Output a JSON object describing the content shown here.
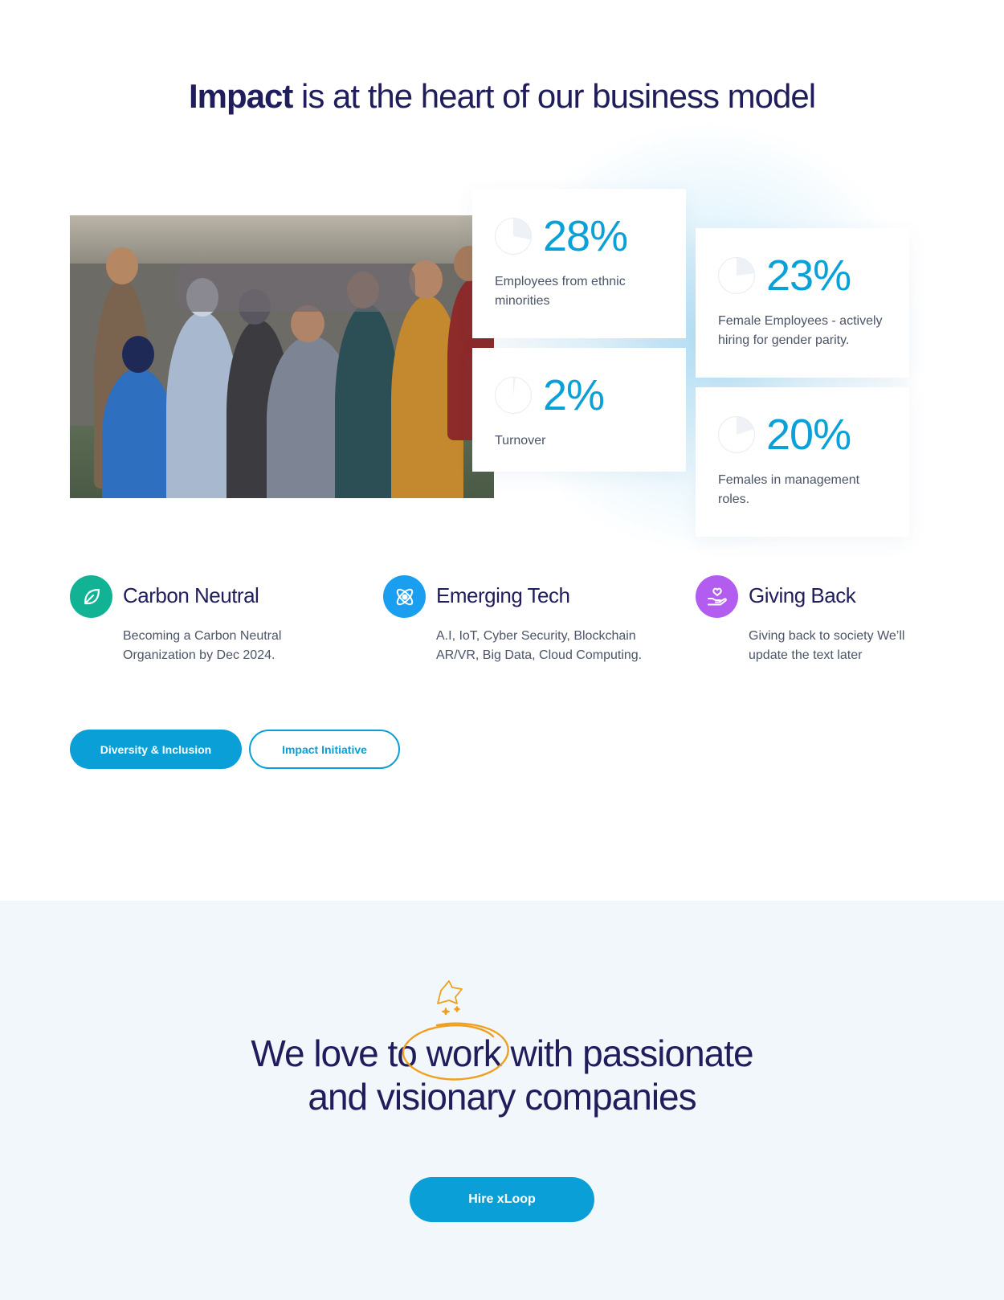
{
  "impact": {
    "title_strong": "Impact",
    "title_rest": " is at the heart of our business model",
    "stats": [
      {
        "value": "28%",
        "label": "Employees from ethnic minorities",
        "fraction": 0.28
      },
      {
        "value": "2%",
        "label": "Turnover",
        "fraction": 0.02
      },
      {
        "value": "23%",
        "label": "Female Employees - actively hiring for gender parity.",
        "fraction": 0.23
      },
      {
        "value": "20%",
        "label": "Females in management roles.",
        "fraction": 0.2
      }
    ],
    "features": [
      {
        "title": "Carbon Neutral",
        "desc": "Becoming a Carbon Neutral Organization by Dec 2024.",
        "icon": "leaf-icon",
        "color": "#12b394"
      },
      {
        "title": "Emerging Tech",
        "desc": "A.I, IoT, Cyber Security, Blockchain AR/VR, Big Data, Cloud Computing.",
        "icon": "atom-icon",
        "color": "#1a9ef0"
      },
      {
        "title": "Giving Back",
        "desc": "Giving back to society We’ll update the text later",
        "icon": "hand-heart-icon",
        "color": "#b25cf0"
      }
    ],
    "buttons": {
      "diversity": "Diversity & Inclusion",
      "impact_initiative": "Impact Initiative"
    }
  },
  "cta": {
    "we": "We ",
    "love": "love",
    "to": " to ",
    "work": "work",
    "with": " with passionate",
    "and": "and visionary ",
    "companies": "companies",
    "hire_button": "Hire xLoop"
  },
  "colors": {
    "navy": "#1f1d5c",
    "accent_blue": "#0a9fd6",
    "accent_green": "#1cae96",
    "swirl_orange": "#f0a020"
  }
}
